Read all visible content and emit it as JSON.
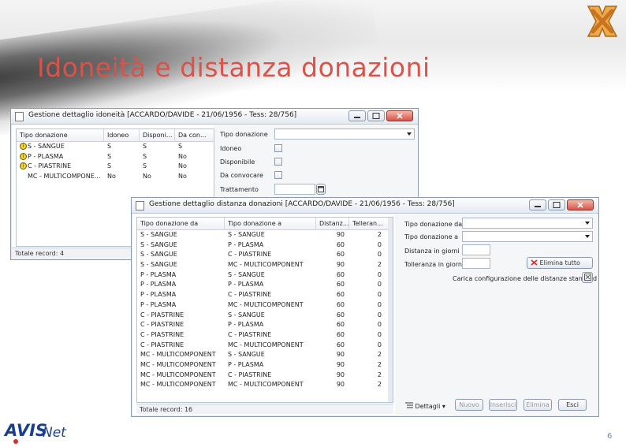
{
  "slide": {
    "title": "Idoneità e distanza donazioni",
    "page_number": "6",
    "logo_text": "AVISNet"
  },
  "window1": {
    "title": "Gestione dettaglio idoneità [ACCARDO/DAVIDE - 21/06/1956 - Tess: 28/756]",
    "columns": [
      "Tipo donazione",
      "Idoneo",
      "Disponi...",
      "Da con..."
    ],
    "rows": [
      {
        "tipo": "S - SANGUE",
        "idoneo": "S",
        "disponibile": "S",
        "da_convocare": "S",
        "info": true
      },
      {
        "tipo": "P - PLASMA",
        "idoneo": "S",
        "disponibile": "S",
        "da_convocare": "No",
        "info": true
      },
      {
        "tipo": "C - PIASTRINE",
        "idoneo": "S",
        "disponibile": "S",
        "da_convocare": "No",
        "info": true
      },
      {
        "tipo": "MC - MULTICOMPONE...",
        "idoneo": "No",
        "disponibile": "No",
        "da_convocare": "No",
        "info": false
      }
    ],
    "status": "Totale record: 4",
    "form": {
      "tipo_donazione_label": "Tipo donazione",
      "idoneo_label": "Idoneo",
      "disponibile_label": "Disponibile",
      "da_convocare_label": "Da convocare",
      "trattamento_label": "Trattamento"
    }
  },
  "window2": {
    "title": "Gestione dettaglio distanza donazioni [ACCARDO/DAVIDE - 21/06/1956 - Tess: 28/756]",
    "columns": [
      "Tipo donazione da",
      "Tipo donazione a",
      "Distanz...",
      "Telleran..."
    ],
    "rows": [
      {
        "da": "S - SANGUE",
        "a": "S - SANGUE",
        "distanza": "90",
        "tolleranza": "2"
      },
      {
        "da": "S - SANGUE",
        "a": "P - PLASMA",
        "distanza": "60",
        "tolleranza": "0"
      },
      {
        "da": "S - SANGUE",
        "a": "C - PIASTRINE",
        "distanza": "60",
        "tolleranza": "0"
      },
      {
        "da": "S - SANGUE",
        "a": "MC - MULTICOMPONENT",
        "distanza": "90",
        "tolleranza": "2"
      },
      {
        "da": "P - PLASMA",
        "a": "S - SANGUE",
        "distanza": "60",
        "tolleranza": "0"
      },
      {
        "da": "P - PLASMA",
        "a": "P - PLASMA",
        "distanza": "60",
        "tolleranza": "0"
      },
      {
        "da": "P - PLASMA",
        "a": "C - PIASTRINE",
        "distanza": "60",
        "tolleranza": "0"
      },
      {
        "da": "P - PLASMA",
        "a": "MC - MULTICOMPONENT",
        "distanza": "60",
        "tolleranza": "0"
      },
      {
        "da": "C - PIASTRINE",
        "a": "S - SANGUE",
        "distanza": "60",
        "tolleranza": "0"
      },
      {
        "da": "C - PIASTRINE",
        "a": "P - PLASMA",
        "distanza": "60",
        "tolleranza": "0"
      },
      {
        "da": "C - PIASTRINE",
        "a": "C - PIASTRINE",
        "distanza": "60",
        "tolleranza": "0"
      },
      {
        "da": "C - PIASTRINE",
        "a": "MC - MULTICOMPONENT",
        "distanza": "60",
        "tolleranza": "0"
      },
      {
        "da": "MC - MULTICOMPONENT",
        "a": "S - SANGUE",
        "distanza": "90",
        "tolleranza": "2"
      },
      {
        "da": "MC - MULTICOMPONENT",
        "a": "P - PLASMA",
        "distanza": "90",
        "tolleranza": "2"
      },
      {
        "da": "MC - MULTICOMPONENT",
        "a": "C - PIASTRINE",
        "distanza": "90",
        "tolleranza": "2"
      },
      {
        "da": "MC - MULTICOMPONENT",
        "a": "MC - MULTICOMPONENT",
        "distanza": "90",
        "tolleranza": "2"
      }
    ],
    "status": "Totale record: 16",
    "form": {
      "tipo_da_label": "Tipo donazione da",
      "tipo_a_label": "Tipo donazione a",
      "distanza_label": "Distanza in giorni",
      "tolleranza_label": "Tolleranza in giorni",
      "elimina_tutto_label": "Elimina tutto",
      "carica_config_label": "Carica configurazione delle distanze standard"
    },
    "toolbar": {
      "dettagli_label": "Dettagli",
      "nuovo_label": "Nuovo",
      "inserisci_label": "Inserisci",
      "elimina_label": "Elimina",
      "esci_label": "Esci"
    }
  },
  "colors": {
    "title_red": "#d9534a",
    "window_border": "#8a9bb0",
    "close_red": "#d9534a"
  }
}
